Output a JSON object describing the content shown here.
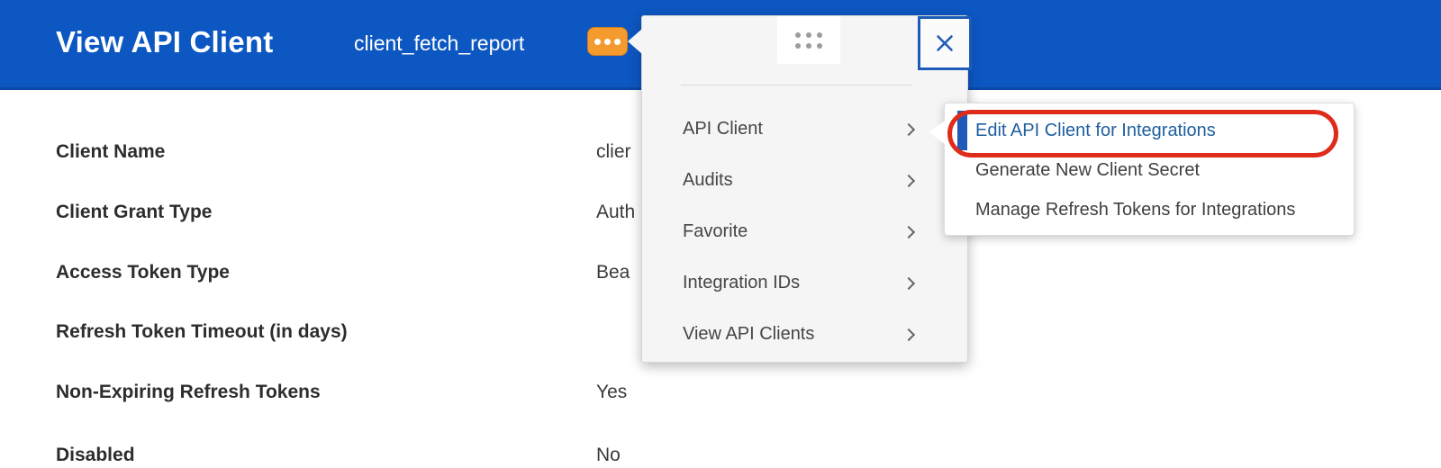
{
  "header": {
    "title": "View API Client",
    "subtitle": "client_fetch_report"
  },
  "fields": [
    {
      "label": "Client Name",
      "value": "clier"
    },
    {
      "label": "Client Grant Type",
      "value": "Auth"
    },
    {
      "label": "Access Token Type",
      "value": "Bea"
    },
    {
      "label": "Refresh Token Timeout (in days)",
      "value": ""
    },
    {
      "label": "Non-Expiring Refresh Tokens",
      "value": "Yes"
    },
    {
      "label": "Disabled",
      "value": "No"
    }
  ],
  "menu": {
    "items": [
      {
        "label": "API Client"
      },
      {
        "label": "Audits"
      },
      {
        "label": "Favorite"
      },
      {
        "label": "Integration IDs"
      },
      {
        "label": "View API Clients"
      }
    ]
  },
  "submenu": {
    "items": [
      {
        "label": "Edit API Client for Integrations",
        "selected": true,
        "annotated": true
      },
      {
        "label": "Generate New Client Secret",
        "selected": false
      },
      {
        "label": "Manage Refresh Tokens for Integrations",
        "selected": false
      }
    ]
  },
  "colors": {
    "header_blue": "#0d57c3",
    "header_blue_dark": "#0a49a8",
    "accent_orange": "#f59b2d",
    "selection_blue": "#1e5bb8",
    "link_blue": "#1e5f9f",
    "annotation_red": "#df2b1a"
  }
}
